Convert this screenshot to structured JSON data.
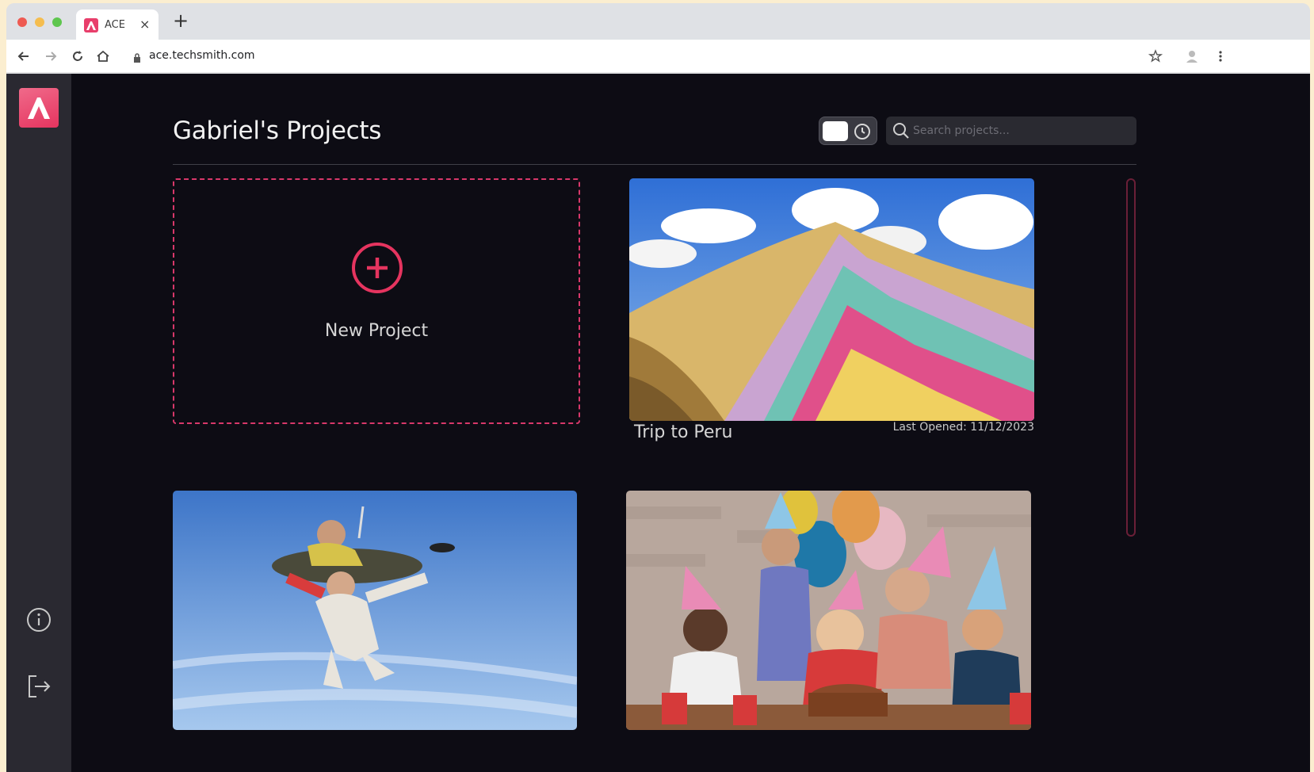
{
  "browser": {
    "tab_title": "ACE",
    "tab_close": "×",
    "new_tab": "+",
    "url": "ace.techsmith.com"
  },
  "sidebar": {
    "logo": "ace-logo",
    "items": [
      {
        "icon": "info-icon"
      },
      {
        "icon": "logout-icon"
      }
    ]
  },
  "header": {
    "title": "Gabriel's Projects",
    "search_placeholder": "Search projects..."
  },
  "new_project": {
    "label": "New Project"
  },
  "projects": [
    {
      "name": "Trip to Peru",
      "date": "Last Opened: 11/12/2023",
      "image": "rainbow-mountain-photo"
    },
    {
      "name": "",
      "date": "",
      "image": "skydiving-photo"
    },
    {
      "name": "",
      "date": "",
      "image": "birthday-party-photo"
    }
  ],
  "colors": {
    "accent": "#e5345f",
    "background": "#0d0c14",
    "sidebar": "#2a2931"
  }
}
